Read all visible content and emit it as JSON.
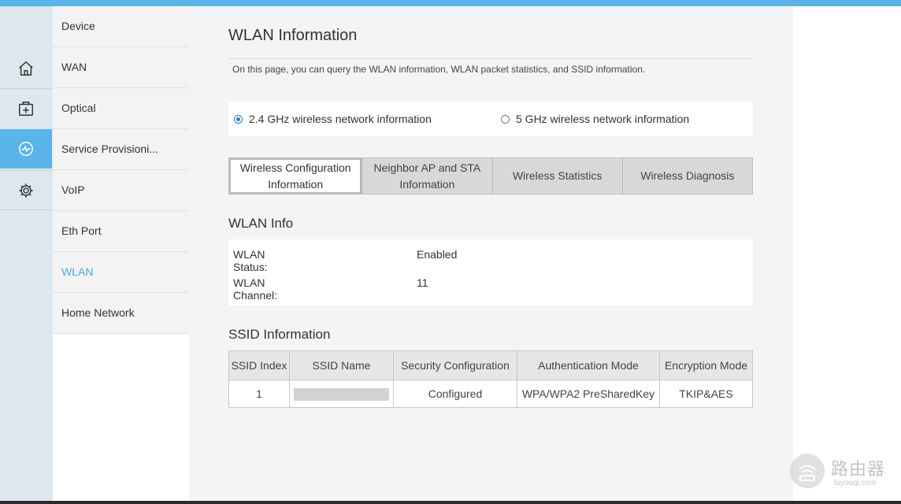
{
  "rail": {
    "items": [
      {
        "icon": "home-icon"
      },
      {
        "icon": "add-box-icon"
      },
      {
        "icon": "diagnose-icon",
        "active": true
      },
      {
        "icon": "gear-icon"
      }
    ]
  },
  "submenu": {
    "items": [
      {
        "label": "Device"
      },
      {
        "label": "WAN"
      },
      {
        "label": "Optical"
      },
      {
        "label": "Service Provisioni..."
      },
      {
        "label": "VoIP"
      },
      {
        "label": "Eth Port"
      },
      {
        "label": "WLAN",
        "active": true
      },
      {
        "label": "Home Network"
      }
    ]
  },
  "page": {
    "title": "WLAN Information",
    "description": "On this page, you can query the WLAN information, WLAN packet statistics, and SSID information."
  },
  "band": {
    "option_24": "2.4 GHz wireless network information",
    "option_5": "5 GHz wireless network information",
    "selected": "2.4 GHz"
  },
  "tabs": [
    {
      "label": "Wireless Configuration Information"
    },
    {
      "label": "Neighbor AP and STA Information"
    },
    {
      "label": "Wireless Statistics"
    },
    {
      "label": "Wireless Diagnosis"
    }
  ],
  "wlan_info": {
    "title": "WLAN Info",
    "status_label": "WLAN Status:",
    "status_value": "Enabled",
    "channel_label": "WLAN Channel:",
    "channel_value": "11"
  },
  "ssid_info": {
    "title": "SSID Information",
    "columns": [
      "SSID Index",
      "SSID Name",
      "Security Configuration",
      "Authentication Mode",
      "Encryption Mode"
    ],
    "rows": [
      {
        "index": "1",
        "name": "",
        "security": "Configured",
        "auth": "WPA/WPA2 PreSharedKey",
        "encryption": "TKIP&AES"
      }
    ]
  },
  "watermark": {
    "text": "路由器",
    "sub": "luyouqi.com"
  },
  "colors": {
    "accent": "#5ab4ea",
    "rail_bg": "#dde7ee",
    "content_bg": "#f3f4f6",
    "active_text": "#4aa8e0"
  }
}
